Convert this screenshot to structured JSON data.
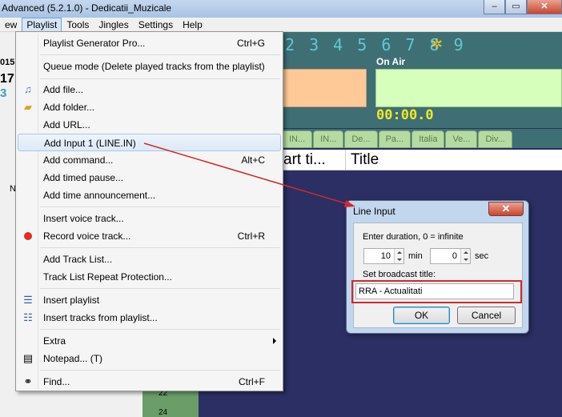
{
  "window": {
    "title": "Advanced (5.2.1.0) - Dedicatii_Muzicale",
    "min": "–",
    "max": "▭",
    "close": "✕"
  },
  "menubar": [
    "ew",
    "Playlist",
    "Tools",
    "Jingles",
    "Settings",
    "Help"
  ],
  "background": {
    "digits": "2 3 4 5 6 7 8 9",
    "on_air_label": "On Air",
    "timer": "00:00.0",
    "tabs": [
      "IN...",
      "IN...",
      "De...",
      "Pa...",
      "Italia",
      "Ve...",
      "Div..."
    ],
    "col_start": "art ti...",
    "col_title": "Title",
    "left_fragments": [
      "015",
      "17",
      "3",
      "N"
    ],
    "meter_values": [
      "22",
      "24"
    ]
  },
  "menu": [
    {
      "label": "Playlist Generator Pro...",
      "shortcut": "Ctrl+G",
      "icon": ""
    },
    {
      "label": "Queue mode (Delete played tracks from the playlist)",
      "shortcut": "",
      "icon": ""
    },
    {
      "label": "Add file...",
      "shortcut": "",
      "icon": "add-file-icon"
    },
    {
      "label": "Add folder...",
      "shortcut": "",
      "icon": "add-folder-icon"
    },
    {
      "label": "Add URL...",
      "shortcut": "",
      "icon": ""
    },
    {
      "label": "Add Input 1 (LINE.IN)",
      "shortcut": "",
      "icon": ""
    },
    {
      "label": "Add command...",
      "shortcut": "Alt+C",
      "icon": ""
    },
    {
      "label": "Add timed pause...",
      "shortcut": "",
      "icon": ""
    },
    {
      "label": "Add time announcement...",
      "shortcut": "",
      "icon": ""
    },
    {
      "label": "Insert voice track...",
      "shortcut": "",
      "icon": ""
    },
    {
      "label": "Record voice track...",
      "shortcut": "Ctrl+R",
      "icon": "record-icon"
    },
    {
      "label": "Add Track List...",
      "shortcut": "",
      "icon": ""
    },
    {
      "label": "Track List Repeat Protection...",
      "shortcut": "",
      "icon": ""
    },
    {
      "label": "Insert playlist",
      "shortcut": "",
      "icon": "insert-playlist-icon"
    },
    {
      "label": "Insert tracks from playlist...",
      "shortcut": "",
      "icon": "insert-tracks-icon"
    },
    {
      "label": "Extra",
      "shortcut": "",
      "icon": ""
    },
    {
      "label": "Notepad... (T)",
      "shortcut": "",
      "icon": "notepad-icon"
    },
    {
      "label": "Find...",
      "shortcut": "Ctrl+F",
      "icon": "binoculars-icon"
    }
  ],
  "dialog": {
    "title": "Line Input",
    "duration_label": "Enter duration, 0 = infinite",
    "minutes_value": "10",
    "minutes_unit": "min",
    "seconds_value": "0",
    "seconds_unit": "sec",
    "broadcast_label": "Set broadcast title:",
    "broadcast_value": "RRA - Actualitati",
    "ok_label": "OK",
    "cancel_label": "Cancel"
  },
  "colors": {
    "annotation_red": "#d3282a",
    "playlist_bg": "#2b2f63",
    "on_air_green": "#d5ffbb",
    "cue_orange": "#ffc997",
    "timer_yellow": "#f3e820"
  }
}
